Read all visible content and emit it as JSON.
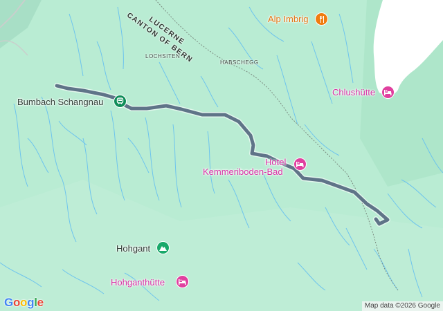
{
  "map": {
    "labels": {
      "lucerne": "LUCERNE",
      "canton_of_bern": "CANTON OF BERN",
      "lochsiten": "LOCHSITEN",
      "habschegg": "HABSCHEGG",
      "alp_imbrig": "Alp Imbrig",
      "chlushutte": "Chlushütte",
      "bumbach_schangnau": "Bumbach Schangnau",
      "hotel_kemmeriboden_line1": "Hotel",
      "hotel_kemmeriboden_line2": "Kemmeriboden-Bad",
      "hohgant": "Hohgant",
      "hohganthutte": "Hohganthütte"
    },
    "icons": {
      "restaurant": "restaurant-icon",
      "hotel": "hotel-icon",
      "mountain": "mountain-icon",
      "transit": "transit-station-icon"
    },
    "colors": {
      "terrain": "#b9ecd3",
      "route": "#5f7488",
      "hotel_pin": "#e0409f",
      "food_pin": "#f07c10",
      "park_pin": "#19a96a",
      "water": "#66c0f0"
    },
    "logo": {
      "letters": [
        "G",
        "o",
        "o",
        "g",
        "l",
        "e"
      ],
      "colors": [
        "#4285F4",
        "#EA4335",
        "#FBBC05",
        "#4285F4",
        "#34A853",
        "#EA4335"
      ]
    },
    "attribution": "Map data ©2026 Google"
  }
}
